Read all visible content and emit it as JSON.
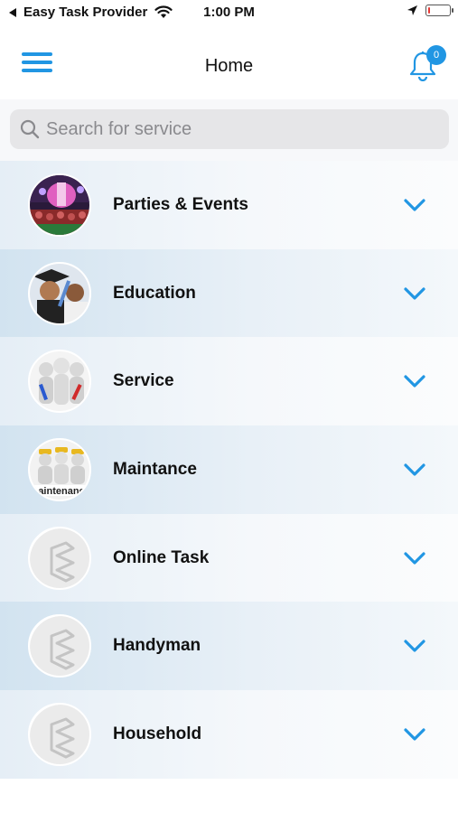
{
  "status_bar": {
    "back_app": "Easy Task Provider",
    "time": "1:00 PM",
    "battery_level": 0.1,
    "battery_color": "#e53935"
  },
  "nav": {
    "title": "Home",
    "menu_icon": "hamburger-menu-icon",
    "bell_icon": "bell-icon",
    "notification_count": "0",
    "accent": "#2196e3"
  },
  "search": {
    "placeholder": "Search for service",
    "value": ""
  },
  "categories": [
    {
      "label": "Parties & Events",
      "image": "party-photo"
    },
    {
      "label": "Education",
      "image": "graduation-photo"
    },
    {
      "label": "Service",
      "image": "service-figures-photo"
    },
    {
      "label": "Maintance",
      "image": "maintenance-figures-photo"
    },
    {
      "label": "Online Task",
      "image": "app-logo-placeholder"
    },
    {
      "label": "Handyman",
      "image": "app-logo-placeholder"
    },
    {
      "label": "Household",
      "image": "app-logo-placeholder"
    }
  ]
}
